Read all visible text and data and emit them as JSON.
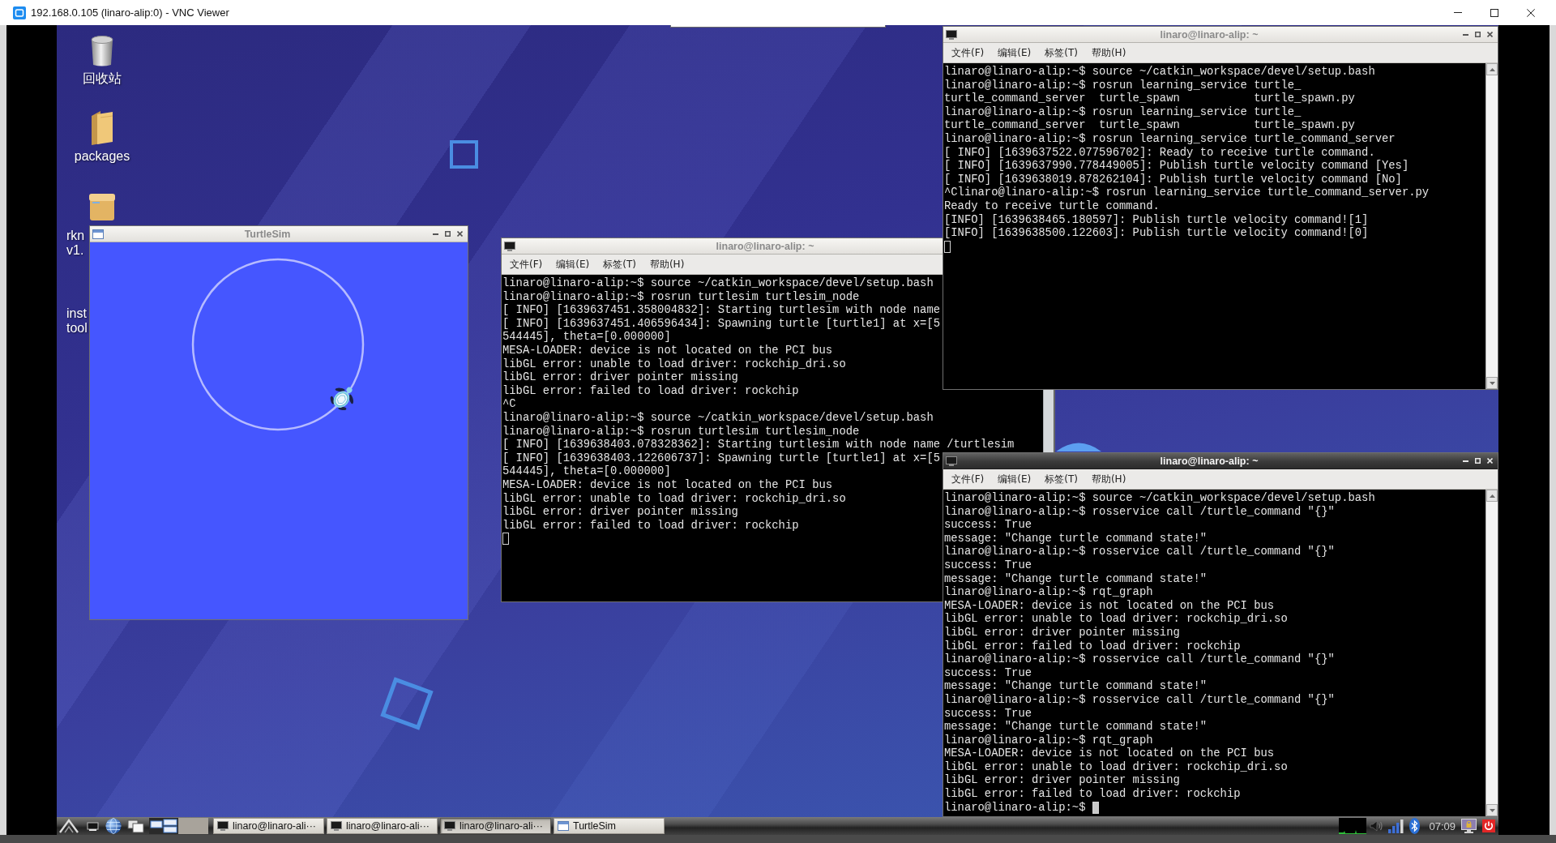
{
  "viewer": {
    "title": "192.168.0.105 (linaro-alip:0) - VNC Viewer"
  },
  "desktop_icons": [
    {
      "kind": "trash",
      "label": [
        "回收站"
      ]
    },
    {
      "kind": "folder",
      "label": [
        "packages"
      ]
    },
    {
      "kind": "archive",
      "label": [
        "rkn",
        "v1."
      ]
    },
    {
      "kind": "covered",
      "label": [
        "inst",
        "tool"
      ]
    }
  ],
  "turtlesim": {
    "title": "TurtleSim",
    "active": false
  },
  "terminals": [
    {
      "title": "linaro@linaro-alip: ~",
      "active": false,
      "menu": [
        "文件(F)",
        "编辑(E)",
        "标签(T)",
        "帮助(H)"
      ],
      "lines": [
        "linaro@linaro-alip:~$ source ~/catkin_workspace/devel/setup.bash",
        "linaro@linaro-alip:~$ rosrun learning_service turtle_",
        "turtle_command_server  turtle_spawn           turtle_spawn.py",
        "linaro@linaro-alip:~$ rosrun learning_service turtle_",
        "turtle_command_server  turtle_spawn           turtle_spawn.py",
        "linaro@linaro-alip:~$ rosrun learning_service turtle_command_server",
        "[ INFO] [1639637522.077596702]: Ready to receive turtle command.",
        "[ INFO] [1639637990.778449005]: Publish turtle velocity command [Yes]",
        "[ INFO] [1639638019.878262104]: Publish turtle velocity command [No]",
        "^Clinaro@linaro-alip:~$ rosrun learning_service turtle_command_server.py",
        "Ready to receive turtle command.",
        "[INFO] [1639638465.180597]: Publish turtle velocity command![1]",
        "[INFO] [1639638500.122603]: Publish turtle velocity command![0]"
      ]
    },
    {
      "title": "linaro@linaro-alip: ~",
      "active": false,
      "menu": [
        "文件(F)",
        "编辑(E)",
        "标签(T)",
        "帮助(H)"
      ],
      "lines": [
        "linaro@linaro-alip:~$ source ~/catkin_workspace/devel/setup.bash",
        "linaro@linaro-alip:~$ rosrun turtlesim turtlesim_node",
        "[ INFO] [1639637451.358004832]: Starting turtlesim with node name",
        "[ INFO] [1639637451.406596434]: Spawning turtle [turtle1] at x=[5",
        "544445], theta=[0.000000]",
        "MESA-LOADER: device is not located on the PCI bus",
        "libGL error: unable to load driver: rockchip_dri.so",
        "libGL error: driver pointer missing",
        "libGL error: failed to load driver: rockchip",
        "^C",
        "linaro@linaro-alip:~$ source ~/catkin_workspace/devel/setup.bash",
        "linaro@linaro-alip:~$ rosrun turtlesim turtlesim_node",
        "[ INFO] [1639638403.078328362]: Starting turtlesim with node name /turtlesim",
        "[ INFO] [1639638403.122606737]: Spawning turtle [turtle1] at x=[5",
        "544445], theta=[0.000000]",
        "MESA-LOADER: device is not located on the PCI bus",
        "libGL error: unable to load driver: rockchip_dri.so",
        "libGL error: driver pointer missing",
        "libGL error: failed to load driver: rockchip"
      ]
    },
    {
      "title": "linaro@linaro-alip: ~",
      "active": true,
      "menu": [
        "文件(F)",
        "编辑(E)",
        "标签(T)",
        "帮助(H)"
      ],
      "lines": [
        "linaro@linaro-alip:~$ source ~/catkin_workspace/devel/setup.bash",
        "linaro@linaro-alip:~$ rosservice call /turtle_command \"{}\"",
        "success: True",
        "message: \"Change turtle command state!\"",
        "linaro@linaro-alip:~$ rosservice call /turtle_command \"{}\"",
        "success: True",
        "message: \"Change turtle command state!\"",
        "linaro@linaro-alip:~$ rqt_graph",
        "MESA-LOADER: device is not located on the PCI bus",
        "libGL error: unable to load driver: rockchip_dri.so",
        "libGL error: driver pointer missing",
        "libGL error: failed to load driver: rockchip",
        "linaro@linaro-alip:~$ rosservice call /turtle_command \"{}\"",
        "success: True",
        "message: \"Change turtle command state!\"",
        "linaro@linaro-alip:~$ rosservice call /turtle_command \"{}\"",
        "success: True",
        "message: \"Change turtle command state!\"",
        "linaro@linaro-alip:~$ rqt_graph",
        "MESA-LOADER: device is not located on the PCI bus",
        "libGL error: unable to load driver: rockchip_dri.so",
        "libGL error: driver pointer missing",
        "libGL error: failed to load driver: rockchip"
      ],
      "prompt": "linaro@linaro-alip:~$"
    }
  ],
  "taskbar": {
    "tasks": [
      {
        "kind": "terminal",
        "label": "linaro@linaro-ali···",
        "selected": false
      },
      {
        "kind": "terminal",
        "label": "linaro@linaro-ali···",
        "selected": false
      },
      {
        "kind": "terminal",
        "label": "linaro@linaro-ali···",
        "selected": true
      },
      {
        "kind": "turtlesim",
        "label": "TurtleSim",
        "selected": false
      }
    ],
    "clock": "07:09"
  }
}
